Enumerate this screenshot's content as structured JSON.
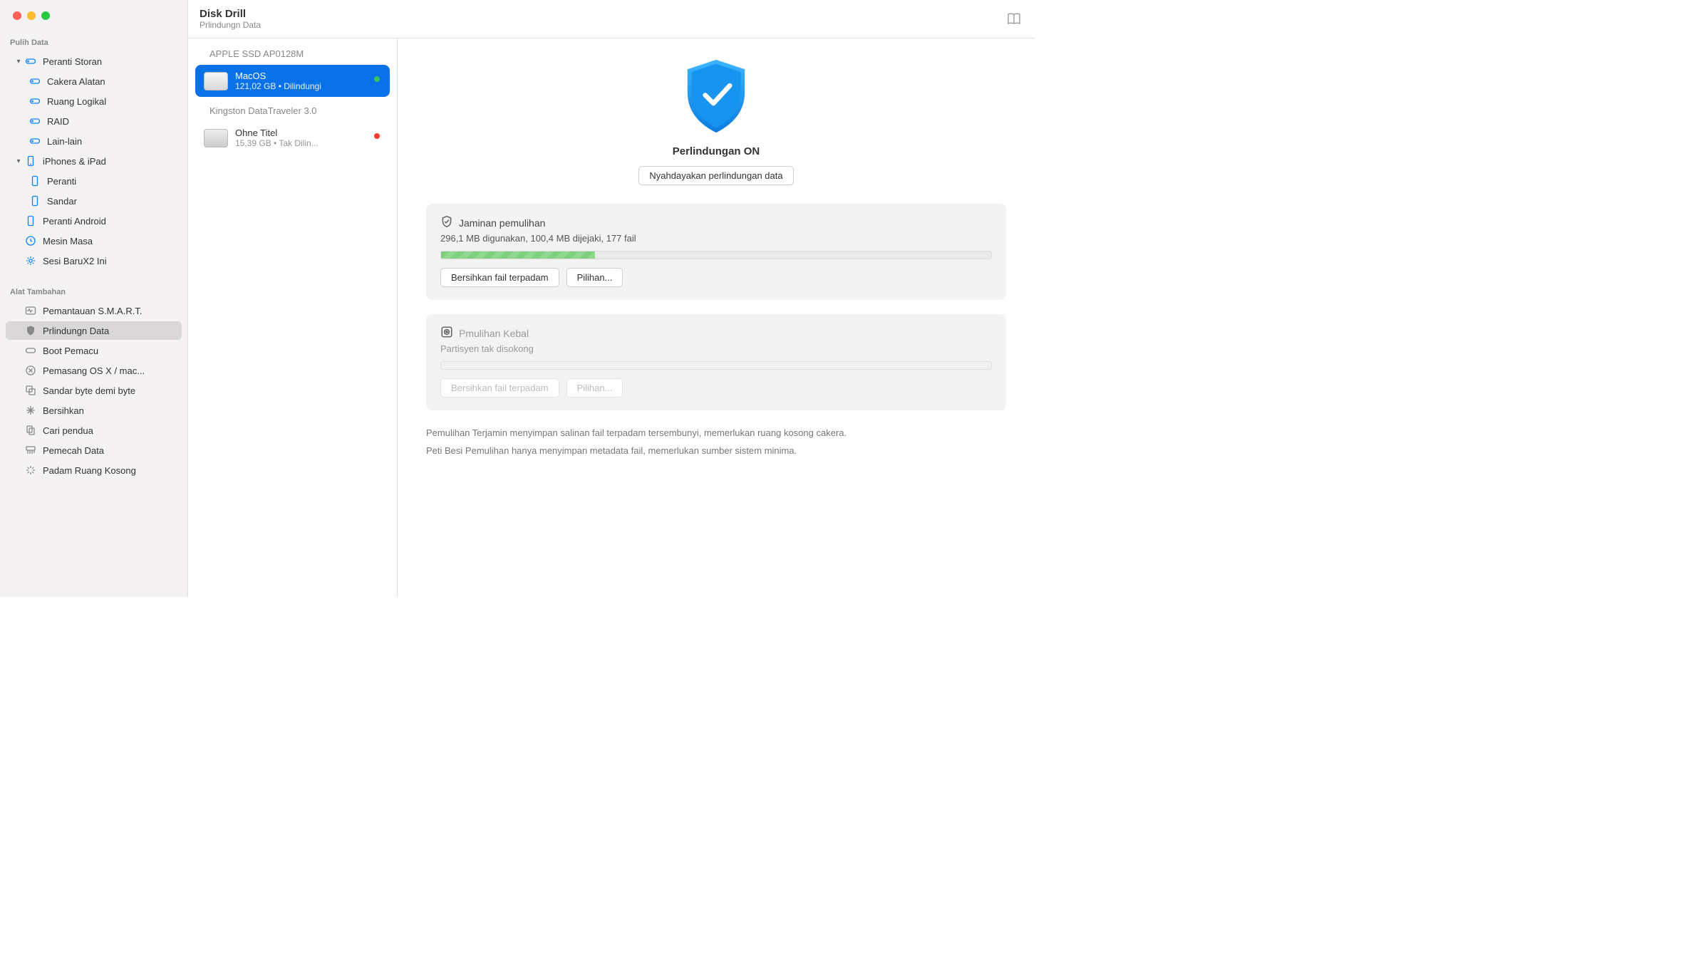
{
  "titlebar": {
    "title": "Disk Drill",
    "subtitle": "Prlindungn Data"
  },
  "sidebar": {
    "section1": "Pulih Data",
    "section2": "Alat Tambahan",
    "items": {
      "storage": "Peranti Storan",
      "tooldrive": "Cakera Alatan",
      "logical": "Ruang Logikal",
      "raid": "RAID",
      "other": "Lain-lain",
      "ios": "iPhones & iPad",
      "device": "Peranti",
      "dock": "Sandar",
      "android": "Peranti Android",
      "timemachine": "Mesin Masa",
      "newsession": "Sesi BaruX2 Ini",
      "smart": "Pemantauan S.M.A.R.T.",
      "dataprotect": "Prlindungn Data",
      "bootdrive": "Boot Pemacu",
      "osxinstall": "Pemasang OS X / mac...",
      "bytebackup": "Sandar byte demi byte",
      "cleanup": "Bersihkan",
      "finddup": "Cari pendua",
      "shredder": "Pemecah Data",
      "erasefree": "Padam Ruang Kosong"
    }
  },
  "devices": {
    "group1": "APPLE SSD AP0128M",
    "d1": {
      "name": "MacOS",
      "sub": "121,02 GB • Dilindungi"
    },
    "group2": "Kingston DataTraveler 3.0",
    "d2": {
      "name": "Ohne Titel",
      "sub": "15,39 GB • Tak Dilin..."
    }
  },
  "main": {
    "hero_title": "Perlindungan ON",
    "disable_btn": "Nyahdayakan perlindungan data",
    "card1": {
      "title": "Jaminan pemulihan",
      "sub": "296,1 MB digunakan, 100,4 MB dijejaki, 177 fail",
      "progress_pct": 28,
      "btn1": "Bersihkan fail terpadam",
      "btn2": "Pilihan..."
    },
    "card2": {
      "title": "Pmulihan Kebal",
      "sub": "Partisyen tak disokong",
      "btn1": "Bersihkan fail terpadam",
      "btn2": "Pilihan..."
    },
    "foot1": "Pemulihan Terjamin menyimpan salinan fail terpadam tersembunyi, memerlukan ruang kosong cakera.",
    "foot2": "Peti Besi Pemulihan hanya menyimpan metadata fail, memerlukan sumber sistem minima."
  }
}
